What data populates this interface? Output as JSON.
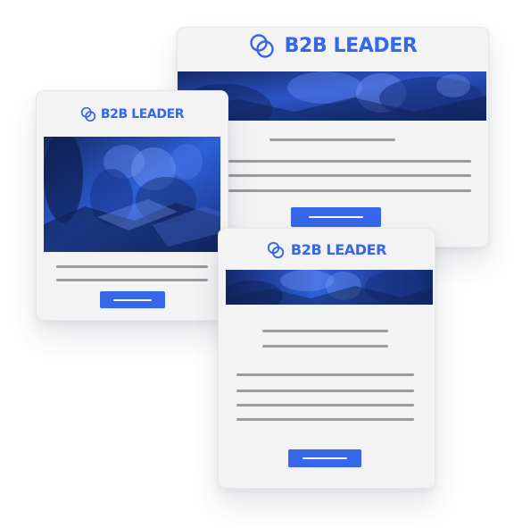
{
  "brand": {
    "name": "B2B LEADER"
  },
  "colors": {
    "accent": "#3567e8",
    "hero_dark": "#1d3d96",
    "card_bg": "#f3f3f4",
    "placeholder_line": "#9a9a9c"
  },
  "icons": {
    "logo": "overlapping-circles-icon"
  }
}
